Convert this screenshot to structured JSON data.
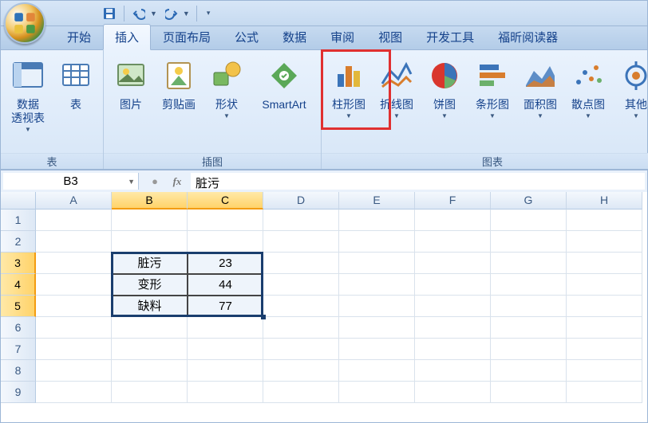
{
  "qat": {
    "save_title": "Save",
    "undo_title": "Undo",
    "redo_title": "Redo"
  },
  "tabs": [
    "开始",
    "插入",
    "页面布局",
    "公式",
    "数据",
    "审阅",
    "视图",
    "开发工具",
    "福昕阅读器"
  ],
  "active_tab_index": 1,
  "ribbon": {
    "groups": [
      {
        "label": "表",
        "items": [
          {
            "label": "数据\n透视表",
            "dd": true,
            "icon": "pivot"
          },
          {
            "label": "表",
            "dd": false,
            "icon": "table"
          }
        ]
      },
      {
        "label": "插图",
        "items": [
          {
            "label": "图片",
            "dd": false,
            "icon": "picture"
          },
          {
            "label": "剪贴画",
            "dd": false,
            "icon": "clipart"
          },
          {
            "label": "形状",
            "dd": true,
            "icon": "shapes"
          },
          {
            "label": "SmartArt",
            "dd": false,
            "icon": "smartart",
            "wide": true
          }
        ]
      },
      {
        "label": "图表",
        "items": [
          {
            "label": "柱形图",
            "dd": true,
            "icon": "column",
            "highlight": true
          },
          {
            "label": "折线图",
            "dd": true,
            "icon": "line"
          },
          {
            "label": "饼图",
            "dd": true,
            "icon": "pie"
          },
          {
            "label": "条形图",
            "dd": true,
            "icon": "bar"
          },
          {
            "label": "面积图",
            "dd": true,
            "icon": "area"
          },
          {
            "label": "散点图",
            "dd": true,
            "icon": "scatter"
          },
          {
            "label": "其他",
            "dd": true,
            "icon": "other"
          }
        ]
      }
    ]
  },
  "namebox": "B3",
  "formula": "脏污",
  "columns": [
    "A",
    "B",
    "C",
    "D",
    "E",
    "F",
    "G",
    "H"
  ],
  "rows": [
    "1",
    "2",
    "3",
    "4",
    "5",
    "6",
    "7",
    "8",
    "9"
  ],
  "selected_cols": [
    "B",
    "C"
  ],
  "selected_rows": [
    "3",
    "4",
    "5"
  ],
  "cells": {
    "B3": "脏污",
    "C3": "23",
    "B4": "变形",
    "C4": "44",
    "B5": "缺料",
    "C5": "77"
  },
  "chart_data": {
    "type": "table",
    "categories": [
      "脏污",
      "变形",
      "缺料"
    ],
    "values": [
      23,
      44,
      77
    ],
    "title": "",
    "xlabel": "",
    "ylabel": ""
  }
}
